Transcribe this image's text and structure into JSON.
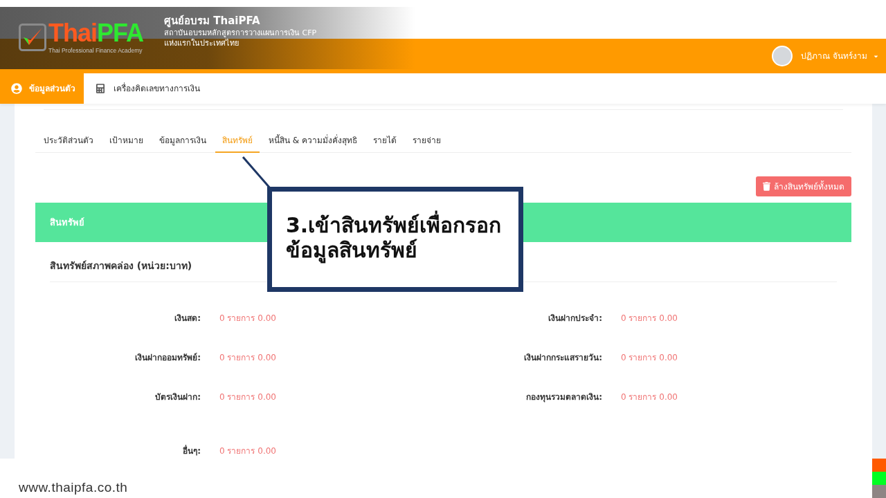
{
  "banner": {
    "wordmark": [
      {
        "text": "Thai",
        "color": "#ff5a1f"
      },
      {
        "text": "PFA",
        "color": "#2ee830"
      }
    ],
    "tagline": "Thai Professional Finance Academy",
    "title": "ศูนย์อบรม ThaiPFA",
    "subtitle_lines": [
      "สถาบันอบรมหลักสูตรการวางแผนการเงิน CFP",
      "แห่งแรกในประเทศไทย"
    ]
  },
  "header": {
    "user_name": "ปฏิภาณ จันทร์งาม"
  },
  "nav": [
    {
      "label": "ข้อมูลส่วนตัว",
      "selected": true
    },
    {
      "label": "เครื่องคิดเลขทางการเงิน",
      "selected": false
    }
  ],
  "tabs": [
    {
      "label": "ประวัติส่วนตัว",
      "selected": false
    },
    {
      "label": "เป้าหมาย",
      "selected": false
    },
    {
      "label": "ข้อมูลการเงิน",
      "selected": false
    },
    {
      "label": "สินทรัพย์",
      "selected": true
    },
    {
      "label": "หนี้สิน & ความมั่งคั่งสุทธิ",
      "selected": false
    },
    {
      "label": "รายได้",
      "selected": false
    },
    {
      "label": "รายจ่าย",
      "selected": false
    }
  ],
  "clear_button": {
    "label": "ล้างสินทรัพย์ทั้งหมด"
  },
  "section": {
    "title": "สินทรัพย์"
  },
  "subsection": {
    "title": "สินทรัพย์สภาพคล่อง (หน่วย:บาท)",
    "rows": [
      [
        {
          "label": "เงินสด:",
          "value": "0 รายการ 0.00"
        },
        {
          "label": "เงินฝากประจำ:",
          "value": "0 รายการ 0.00"
        }
      ],
      [
        {
          "label": "เงินฝากออมทรัพย์:",
          "value": "0 รายการ 0.00"
        },
        {
          "label": "เงินฝากกระแสรายวัน:",
          "value": "0 รายการ 0.00"
        }
      ],
      [
        {
          "label": "บัตรเงินฝาก:",
          "value": "0 รายการ 0.00"
        },
        {
          "label": "กองทุนรวมตลาดเงิน:",
          "value": "0 รายการ 0.00"
        }
      ],
      [
        {
          "label": "อื่นๆ:",
          "value": "0 รายการ 0.00"
        }
      ]
    ]
  },
  "callout": {
    "lines": [
      "3.เข้าสินทรัพย์เพื่อกรอก",
      "ข้อมูลสินทรัพย์"
    ]
  },
  "footer": {
    "url": "www.thaipfa.co.th"
  }
}
